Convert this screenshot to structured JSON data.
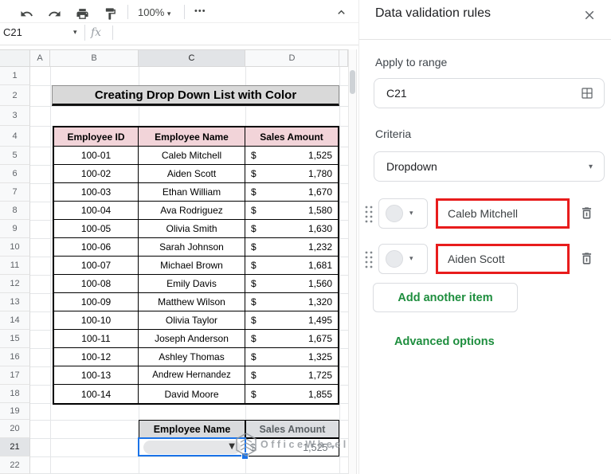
{
  "toolbar": {
    "zoom": "100%",
    "more_glyph": "•••",
    "icons": [
      "undo-icon",
      "redo-icon",
      "print-icon",
      "paint-format-icon",
      "zoom-caret-icon",
      "more-icon",
      "collapse-toolbar-icon"
    ]
  },
  "name_box": {
    "value": "C21",
    "caret": "▾",
    "fx": "fx"
  },
  "sheet": {
    "column_headers": [
      "A",
      "B",
      "C",
      "D"
    ],
    "selected_column": "C",
    "row_numbers": [
      "1",
      "2",
      "3",
      "4",
      "5",
      "6",
      "7",
      "8",
      "9",
      "10",
      "11",
      "12",
      "13",
      "14",
      "15",
      "16",
      "17",
      "18",
      "19",
      "20",
      "21",
      "22"
    ],
    "selected_row": "21",
    "title": "Creating Drop Down List with Color",
    "table": {
      "headers": [
        "Employee ID",
        "Employee Name",
        "Sales Amount"
      ],
      "rows": [
        {
          "id": "100-01",
          "name": "Caleb Mitchell",
          "cur": "$",
          "amount": "1,525"
        },
        {
          "id": "100-02",
          "name": "Aiden Scott",
          "cur": "$",
          "amount": "1,780"
        },
        {
          "id": "100-03",
          "name": "Ethan William",
          "cur": "$",
          "amount": "1,670"
        },
        {
          "id": "100-04",
          "name": "Ava Rodriguez",
          "cur": "$",
          "amount": "1,580"
        },
        {
          "id": "100-05",
          "name": "Olivia Smith",
          "cur": "$",
          "amount": "1,630"
        },
        {
          "id": "100-06",
          "name": "Sarah Johnson",
          "cur": "$",
          "amount": "1,232"
        },
        {
          "id": "100-07",
          "name": "Michael Brown",
          "cur": "$",
          "amount": "1,681"
        },
        {
          "id": "100-08",
          "name": "Emily Davis",
          "cur": "$",
          "amount": "1,560"
        },
        {
          "id": "100-09",
          "name": "Matthew Wilson",
          "cur": "$",
          "amount": "1,320"
        },
        {
          "id": "100-10",
          "name": "Olivia Taylor",
          "cur": "$",
          "amount": "1,495"
        },
        {
          "id": "100-11",
          "name": "Joseph Anderson",
          "cur": "$",
          "amount": "1,675"
        },
        {
          "id": "100-12",
          "name": "Ashley Thomas",
          "cur": "$",
          "amount": "1,325"
        },
        {
          "id": "100-13",
          "name": "Andrew Hernandez",
          "cur": "$",
          "amount": "1,725"
        },
        {
          "id": "100-14",
          "name": "David Moore",
          "cur": "$",
          "amount": "1,855"
        }
      ]
    },
    "mini_table": {
      "name_header": "Employee Name",
      "amount_header": "Sales Amount",
      "cur": "$",
      "amount": "1,525",
      "dropdown_caret": "▼",
      "amount_caret": "▾"
    },
    "watermark": "OfficeWheel"
  },
  "panel": {
    "title": "Data validation rules",
    "apply_label": "Apply to range",
    "range_value": "C21",
    "criteria_label": "Criteria",
    "criteria_value": "Dropdown",
    "select_caret": "▾",
    "chip_caret": "▾",
    "items": [
      {
        "value": "Caleb Mitchell"
      },
      {
        "value": "Aiden Scott"
      }
    ],
    "add_button": "Add another item",
    "advanced_link": "Advanced options"
  },
  "colors": {
    "selection_blue": "#1a73e8",
    "highlight_red": "#e81c1c",
    "accent_green": "#1e8e3e",
    "table_header_pink": "#f2d4d9",
    "title_bar_gray": "#d9d9d9"
  }
}
